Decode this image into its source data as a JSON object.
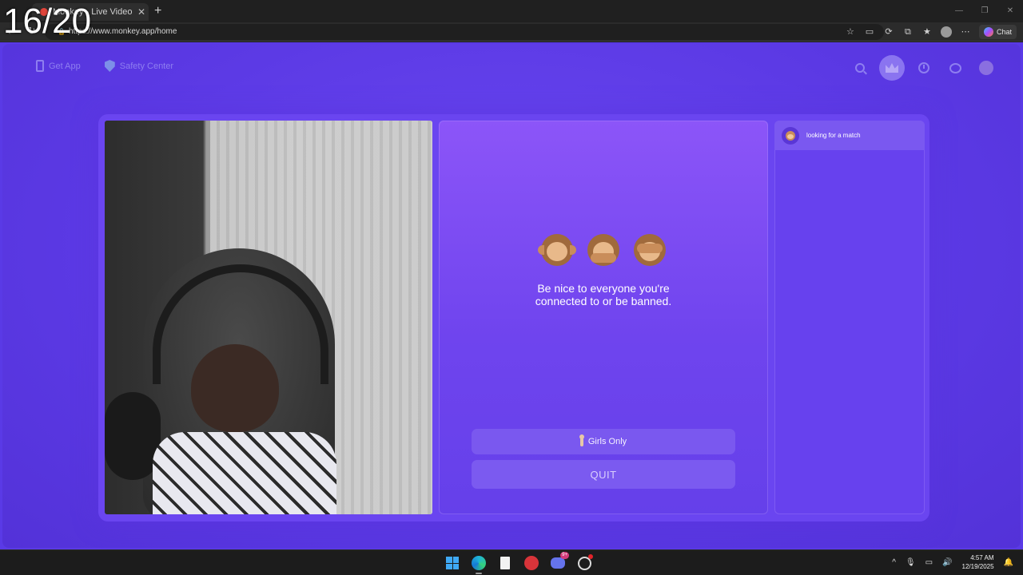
{
  "overlay": {
    "counter": "16/20"
  },
  "browser": {
    "tab_title": "Monkey - Live Video Chat",
    "tab_close": "✕",
    "new_tab": "+",
    "url": "https://www.monkey.app/home",
    "chat_label": "Chat",
    "window_controls": [
      "—",
      "❐",
      "✕"
    ]
  },
  "page": {
    "nav_left": [
      {
        "label": "Get App",
        "icon": "phone-icon"
      },
      {
        "label": "Safety Center",
        "icon": "shield-icon"
      }
    ],
    "nav_right_icons": [
      "search-icon",
      "crown-icon",
      "clock-icon",
      "message-icon",
      "avatar-icon"
    ],
    "center": {
      "monkeys": [
        "hear-no-evil-monkey-icon",
        "speak-no-evil-monkey-icon",
        "see-no-evil-monkey-icon"
      ],
      "rule_text": "Be nice to everyone you're\nconnected to or be banned.",
      "girls_only_label": "Girls Only",
      "quit_label": "QUIT"
    },
    "chat": {
      "status_text": "looking for a match"
    }
  },
  "taskbar": {
    "discord_badge": "9+",
    "time": "4:57 AM",
    "date": "12/19/2025"
  },
  "colors": {
    "page_bg": "#5a3ae6",
    "card_bg": "#6a45f0",
    "button_bg": "#7a58ef"
  }
}
